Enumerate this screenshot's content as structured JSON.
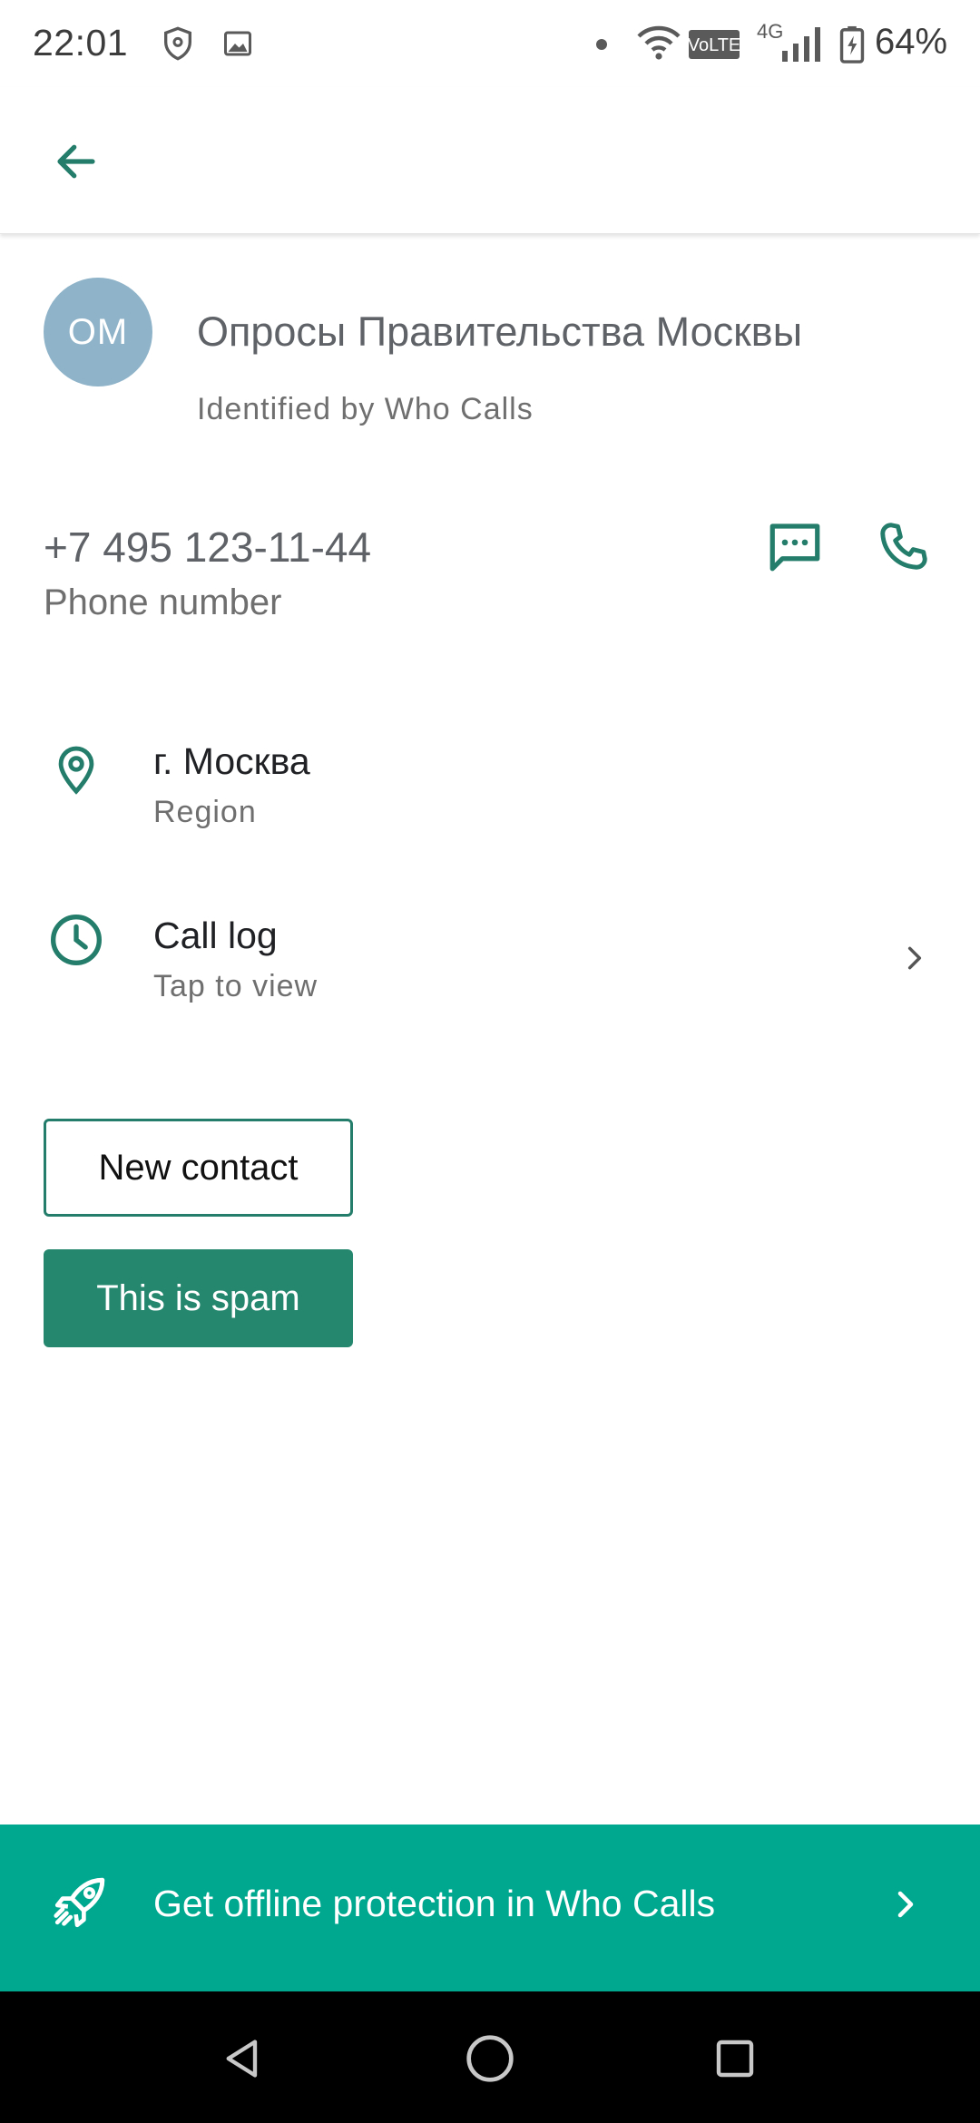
{
  "status_bar": {
    "time": "22:01",
    "network_type": "4G",
    "volte": "VoLTE",
    "battery_percent": "64%",
    "icons": [
      "shield-icon",
      "image-icon",
      "dot-icon",
      "wifi-icon",
      "volte-icon",
      "signal-icon",
      "battery-icon"
    ]
  },
  "app_bar": {
    "back_icon": "arrow-left-icon"
  },
  "contact": {
    "initials": "ОМ",
    "name": "Опросы Правительства Москвы",
    "identified_by": "Identified by Who Calls",
    "avatar_color": "#8fb4c9"
  },
  "phone": {
    "number": "+7 495 123-11-44",
    "label": "Phone number",
    "actions": [
      "message-icon",
      "phone-icon"
    ]
  },
  "info_rows": [
    {
      "primary": "г. Москва",
      "secondary": "Region",
      "icon": "location-pin-icon"
    },
    {
      "primary": "Call log",
      "secondary": "Tap to view",
      "icon": "clock-icon"
    }
  ],
  "buttons": {
    "new_contact": "New contact",
    "spam": "This is spam"
  },
  "promo": {
    "text": "Get offline protection in Who Calls",
    "icon": "rocket-icon",
    "color": "#00a88f"
  },
  "colors": {
    "accent": "#247d6a",
    "button_fill": "#26876f"
  },
  "nav": [
    "back-triangle-icon",
    "home-circle-icon",
    "recents-square-icon"
  ]
}
